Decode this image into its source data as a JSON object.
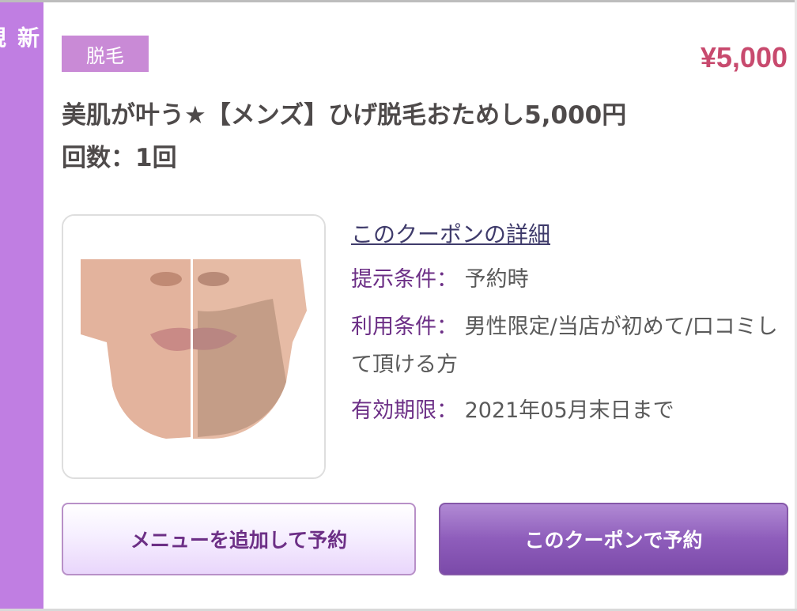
{
  "side_badge": {
    "line1": "新",
    "line2": "規",
    "color": "#c07ee2"
  },
  "coupon": {
    "category": "脱毛",
    "price": "¥5,000",
    "title": "美肌が叶う★【メンズ】ひげ脱毛おためし5,000円",
    "count": "回数：1回",
    "image_alt": "before-after beard removal face photo",
    "detail_link": "このクーポンの詳細",
    "conditions": [
      {
        "key": "提示条件：",
        "value": "予約時"
      },
      {
        "key": "利用条件：",
        "value": "男性限定/当店が初めて/口コミして頂ける方"
      },
      {
        "key": "有効期限：",
        "value": "2021年05月末日まで"
      }
    ]
  },
  "buttons": {
    "add_menu": "メニューを追加して予約",
    "book_coupon": "このクーポンで予約"
  },
  "colors": {
    "accent_purple": "#c07ee2",
    "price_red": "#c84a6e",
    "button_primary": "#8e5dbb"
  }
}
